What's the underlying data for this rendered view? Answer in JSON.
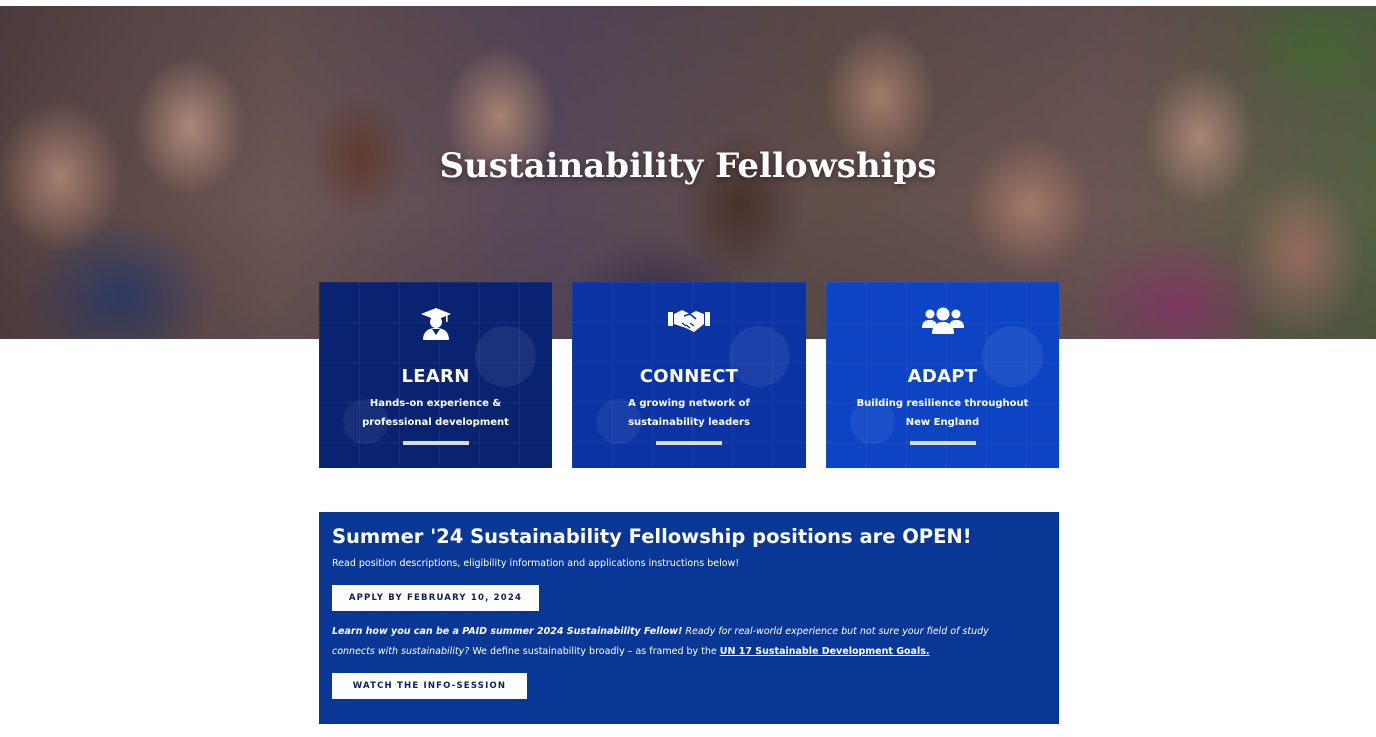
{
  "hero": {
    "title": "Sustainability Fellowships",
    "image_alt": "Group photo of sustainability fellows"
  },
  "cards": [
    {
      "icon": "graduate-icon",
      "title": "LEARN",
      "description": "Hands-on experience & professional development",
      "color": "#0a2371"
    },
    {
      "icon": "handshake-icon",
      "title": "CONNECT",
      "description": "A growing network of sustainability leaders",
      "color": "#0b33a3"
    },
    {
      "icon": "users-icon",
      "title": "ADAPT",
      "description": "Building resilience throughout New England",
      "color": "#0d44c4"
    }
  ],
  "announcement": {
    "heading": "Summer '24 Sustainability Fellowship positions are OPEN!",
    "subtext": "Read position descriptions, eligibility information and applications instructions below!",
    "apply_button": "APPLY BY FEBRUARY 10, 2024",
    "body_bold_italic": "Learn how you can be a PAID summer 2024 Sustainability Fellow!",
    "body_italic": " Ready for real-world experience but not sure your field of study connects with sustainability?",
    "body_plain": " We define sustainability broadly – as framed by the ",
    "body_link": "UN 17 Sustainable Development Goals.",
    "watch_button": "WATCH THE INFO-SESSION",
    "background_color": "#083795"
  }
}
